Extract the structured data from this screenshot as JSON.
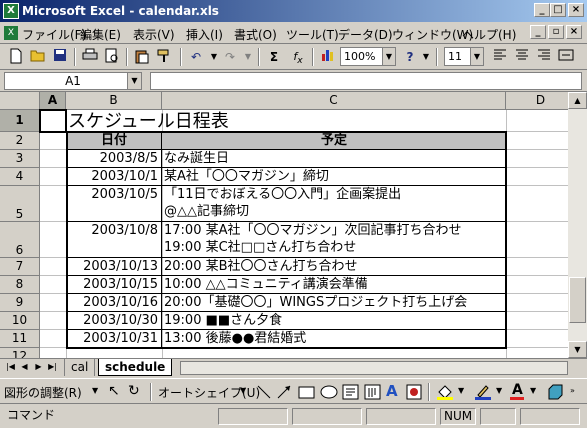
{
  "window": {
    "title": "Microsoft Excel - calendar.xls",
    "app_icon": "excel-icon",
    "min": "_",
    "max": "□",
    "close": "×"
  },
  "menu": {
    "items": [
      "ファイル(F)",
      "編集(E)",
      "表示(V)",
      "挿入(I)",
      "書式(O)",
      "ツール(T)",
      "データ(D)",
      "ウィンドウ(W)",
      "ヘルプ(H)"
    ],
    "doc_min": "_",
    "doc_restore": "▫",
    "doc_close": "×"
  },
  "toolbar": {
    "zoom": "100%",
    "font_size": "11",
    "help": "?"
  },
  "formula_bar": {
    "name_box": "A1",
    "fx": "fx",
    "value": ""
  },
  "columns": [
    "A",
    "B",
    "C",
    "D"
  ],
  "rows": [
    "1",
    "2",
    "3",
    "4",
    "5",
    "6",
    "7",
    "8",
    "9",
    "10",
    "11",
    "12"
  ],
  "sheet": {
    "title": "スケジュール日程表",
    "header_date": "日付",
    "header_plan": "予定",
    "entries": [
      {
        "date": "2003/8/5",
        "lines": [
          "なみ誕生日"
        ]
      },
      {
        "date": "2003/10/1",
        "lines": [
          "某A社「〇〇マガジン」締切"
        ]
      },
      {
        "date": "2003/10/5",
        "lines": [
          "「11日でおぼえる〇〇入門」企画案提出",
          "@△△記事締切"
        ]
      },
      {
        "date": "2003/10/8",
        "lines": [
          "17:00 某A社「〇〇マガジン」次回記事打ち合わせ",
          "19:00 某C社□□さん打ち合わせ"
        ]
      },
      {
        "date": "2003/10/13",
        "lines": [
          "20:00 某B社〇〇さん打ち合わせ"
        ]
      },
      {
        "date": "2003/10/15",
        "lines": [
          "10:00 △△コミュニティ講演会準備"
        ]
      },
      {
        "date": "2003/10/16",
        "lines": [
          "20:00「基礎〇〇」WINGSプロジェクト打ち上げ会"
        ]
      },
      {
        "date": "2003/10/30",
        "lines": [
          "19:00 ■■さん夕食"
        ]
      },
      {
        "date": "2003/10/31",
        "lines": [
          "13:00 後藤●●君結婚式"
        ]
      }
    ]
  },
  "tabs": {
    "items": [
      "cal",
      "schedule"
    ],
    "active": "schedule"
  },
  "drawing": {
    "adjust": "図形の調整(R)",
    "autoshape": "オートシェイプ(U)"
  },
  "status": {
    "mode": "コマンド",
    "num": "NUM"
  },
  "colors": {
    "title_start": "#0a246a",
    "title_end": "#a6caf0",
    "chrome": "#d4d0c8",
    "header_fill": "#c0c0c0"
  }
}
